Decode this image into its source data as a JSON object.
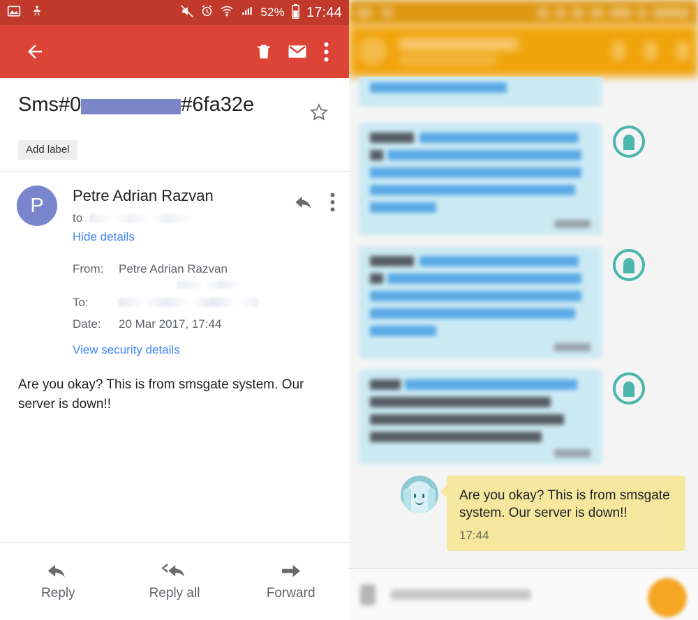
{
  "left_panel": {
    "app": "gmail",
    "status_bar": {
      "time": "17:44",
      "battery_percent": "52%",
      "icons": [
        "image-icon",
        "usb-debug-icon",
        "mute-icon",
        "alarm-icon",
        "wifi-icon",
        "signal-icon",
        "battery-icon"
      ],
      "background_color": "#c0392b"
    },
    "app_bar": {
      "background_color": "#db4437",
      "back_label": "Back",
      "delete_label": "Delete",
      "mark_unread_label": "Mark unread",
      "more_label": "More options"
    },
    "subject": {
      "prefix": "Sms#0",
      "redacted": "",
      "suffix": "#6fa32e",
      "add_label_chip": "Add label",
      "star_label": "Star"
    },
    "message": {
      "avatar_initial": "P",
      "avatar_color": "#7986cb",
      "sender_name": "Petre Adrian Razvan",
      "to_prefix": "to",
      "to_recipient": "",
      "details_toggle": "Hide details",
      "details": [
        {
          "key": "From:",
          "value": "Petre Adrian Razvan",
          "redacted": false
        },
        {
          "key": "To:",
          "value": "",
          "redacted": true
        },
        {
          "key": "Date:",
          "value": "20 Mar 2017, 17:44",
          "redacted": false
        }
      ],
      "security_link": "View security details",
      "body": "Are you okay? This is from smsgate system. Our server is down!!"
    },
    "bottom_actions": [
      {
        "label": "Reply",
        "icon": "reply-icon"
      },
      {
        "label": "Reply all",
        "icon": "reply-all-icon"
      },
      {
        "label": "Forward",
        "icon": "forward-icon"
      }
    ]
  },
  "right_panel": {
    "app": "messaging",
    "status_bar": {
      "background_color": "#dd9409"
    },
    "app_bar": {
      "background_color": "#f0a30a",
      "contact_name": "",
      "contact_subtitle": "",
      "call_label": "Call",
      "delete_label": "Delete",
      "more_label": "More options"
    },
    "conversation": {
      "incoming_bubble_color": "#cceaf4",
      "outgoing_bubble_color": "#f5e79e",
      "messages": [
        {
          "direction": "incoming",
          "text": "",
          "time": "",
          "redacted": true,
          "clipped": true
        },
        {
          "direction": "incoming",
          "text": "",
          "time": "",
          "redacted": true,
          "clipped": false
        },
        {
          "direction": "incoming",
          "text": "",
          "time": "",
          "redacted": true,
          "clipped": false
        },
        {
          "direction": "outgoing",
          "text": "Are you okay? This is from smsgate system. Our server is down!!",
          "time": "17:44",
          "redacted": false,
          "clipped": false
        }
      ]
    },
    "input_bar": {
      "attach_icon": "attachment-icon",
      "placeholder": "Enter message",
      "send_fab_color": "#f5a623",
      "send_label": "Send"
    }
  }
}
